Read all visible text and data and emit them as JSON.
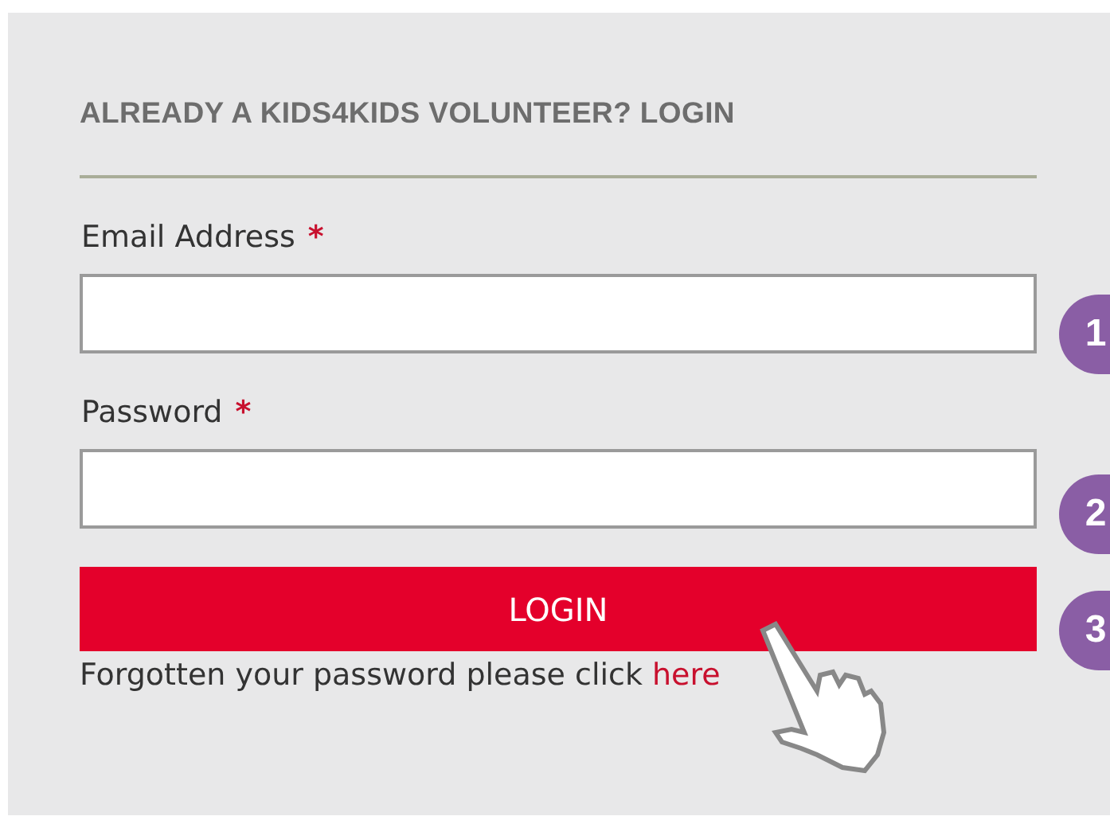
{
  "heading": "ALREADY A KIDS4KIDS VOLUNTEER? LOGIN",
  "fields": [
    {
      "label": "Email Address",
      "required_mark": "*"
    },
    {
      "label": "Password",
      "required_mark": "*"
    }
  ],
  "button": "LOGIN",
  "forgot": {
    "text": "Forgotten your password please click",
    "link": "here"
  },
  "callouts": [
    "1",
    "2",
    "3"
  ]
}
